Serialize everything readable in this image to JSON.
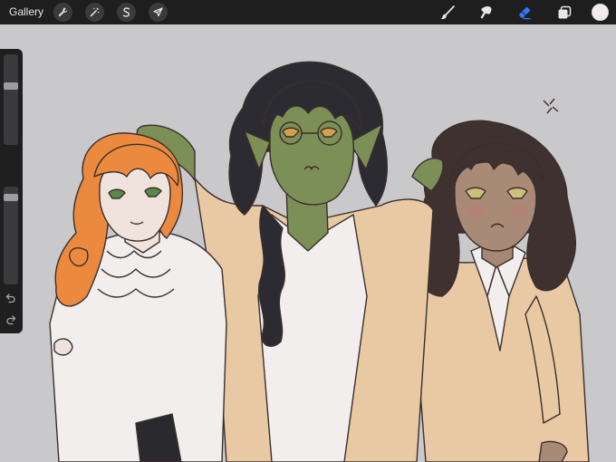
{
  "toolbar": {
    "gallery_label": "Gallery",
    "left_tools": [
      {
        "name": "actions",
        "icon": "wrench-icon"
      },
      {
        "name": "adjustments",
        "icon": "magic-wand-icon"
      },
      {
        "name": "selection",
        "icon": "selection-s-icon"
      },
      {
        "name": "transform",
        "icon": "arrow-cursor-icon"
      }
    ],
    "right_tools": [
      {
        "name": "brush",
        "icon": "brush-icon"
      },
      {
        "name": "smudge",
        "icon": "smudge-icon"
      },
      {
        "name": "eraser",
        "icon": "eraser-icon",
        "active": true
      },
      {
        "name": "layers",
        "icon": "layers-icon"
      }
    ],
    "active_tool_color": "#2f7bf6",
    "current_color": "#f2ecec"
  },
  "sidebar": {
    "brush_size_level": 0.66,
    "opacity_level": 0.92,
    "modify_icon": "square-icon",
    "undo_icon": "undo-icon",
    "redo_icon": "redo-icon"
  },
  "canvas": {
    "background_color": "#c9c9cb"
  }
}
